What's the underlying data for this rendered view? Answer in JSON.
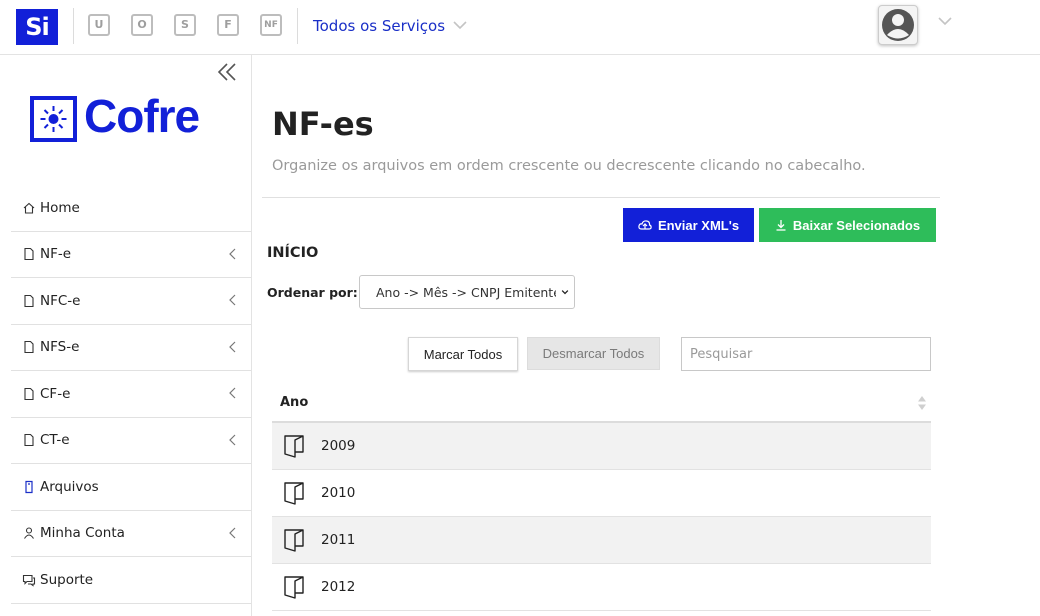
{
  "topbar": {
    "logo_text": "Si",
    "app_icons": [
      "U",
      "O",
      "S",
      "F",
      "NF"
    ],
    "services_label": "Todos os Serviços",
    "accent_color": "#1220d8"
  },
  "sidebar": {
    "brand": "Cofre",
    "items": [
      {
        "label": "Home",
        "icon": "home-icon",
        "has_submenu": false
      },
      {
        "label": "NF-e",
        "icon": "file-icon",
        "has_submenu": true
      },
      {
        "label": "NFC-e",
        "icon": "file-icon",
        "has_submenu": true
      },
      {
        "label": "NFS-e",
        "icon": "file-icon",
        "has_submenu": true
      },
      {
        "label": "CF-e",
        "icon": "file-icon",
        "has_submenu": true
      },
      {
        "label": "CT-e",
        "icon": "file-icon",
        "has_submenu": true
      },
      {
        "label": "Arquivos",
        "icon": "archive-icon",
        "has_submenu": false
      },
      {
        "label": "Minha Conta",
        "icon": "user-icon",
        "has_submenu": true
      },
      {
        "label": "Suporte",
        "icon": "support-icon",
        "has_submenu": false
      }
    ]
  },
  "main": {
    "title": "NF-es",
    "subtitle": "Organize os arquivos em ordem crescente ou decrescente clicando no cabecalho.",
    "upload_button": "Enviar XML's",
    "download_button": "Baixar Selecionados",
    "breadcrumb": "INÍCIO",
    "order_label": "Ordenar por:",
    "order_value": "Ano -> Mês -> CNPJ Emitente",
    "mark_all": "Marcar Todos",
    "unmark_all": "Desmarcar Todos",
    "search_placeholder": "Pesquisar",
    "table": {
      "header": "Ano",
      "rows": [
        "2009",
        "2010",
        "2011",
        "2012"
      ]
    },
    "colors": {
      "primary": "#1220d8",
      "success": "#2ebd5a"
    }
  }
}
